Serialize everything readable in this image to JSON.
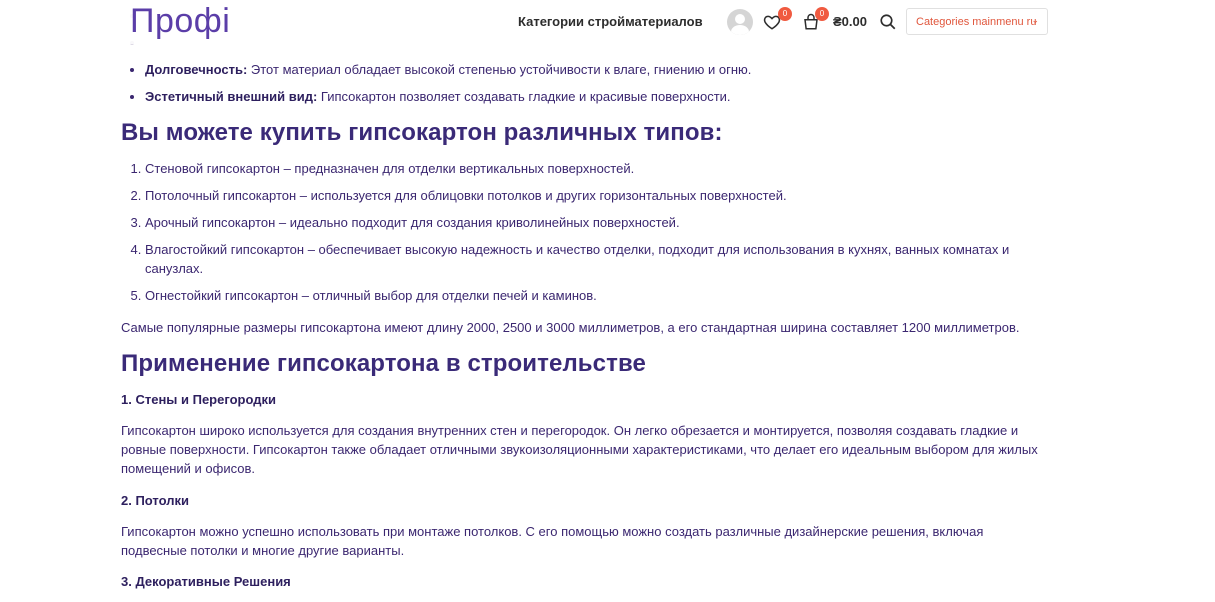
{
  "header": {
    "logo": "Профі",
    "nav_categories": "Категории стройматериалов",
    "wishlist_count": "0",
    "cart_count": "0",
    "cart_total": "₴0.00",
    "lang_select": "Categories mainmenu ru",
    "colors": {
      "accent": "#f05a40",
      "logo": "#5b3ea8"
    },
    "icons": [
      "user-avatar-icon",
      "heart-icon",
      "cart-icon",
      "search-icon",
      "chevron-down-icon"
    ]
  },
  "benefits": [
    {
      "title": "Долговечность:",
      "text": " Этот материал обладает высокой степенью устойчивости к влаге, гниению и огню."
    },
    {
      "title": "Эстетичный внешний вид:",
      "text": " Гипсокартон позволяет создавать гладкие и красивые поверхности."
    }
  ],
  "types_heading": "Вы можете купить гипсокартон различных типов:",
  "types": [
    "Стеновой гипсокартон – предназначен для отделки вертикальных поверхностей.",
    "Потолочный гипсокартон – используется для облицовки потолков и других горизонтальных поверхностей.",
    "Арочный гипсокартон – идеально подходит для создания криволинейных поверхностей.",
    "Влагостойкий гипсокартон – обеспечивает высокую надежность и качество отделки, подходит для использования в кухнях, ванных комнатах и санузлах.",
    "Огнестойкий гипсокартон – отличный выбор для отделки печей и каминов."
  ],
  "sizes_text": "Самые популярные размеры гипсокартона имеют длину 2000, 2500 и 3000 миллиметров, а его стандартная ширина составляет 1200 миллиметров.",
  "usage_heading": "Применение гипсокартона в строительстве",
  "sections": [
    {
      "title": "1. Стены и Перегородки",
      "text": "Гипсокартон широко используется для создания внутренних стен и перегородок. Он легко обрезается и монтируется, позволяя создавать гладкие и ровные поверхности. Гипсокартон также обладает отличными звукоизоляционными характеристиками, что делает его идеальным выбором для жилых помещений и офисов."
    },
    {
      "title": "2. Потолки",
      "text": "Гипсокартон можно успешно использовать при монтаже потолков. С его помощью можно создать различные дизайнерские решения, включая подвесные потолки и многие другие варианты."
    },
    {
      "title": "3. Декоративные Решения"
    }
  ]
}
